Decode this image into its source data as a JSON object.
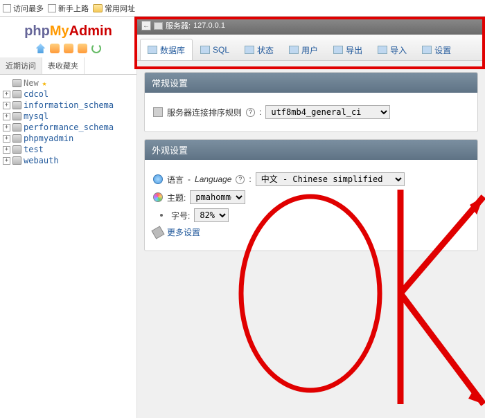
{
  "bookmarks": {
    "visit": "访问最多",
    "newbie": "新手上路",
    "common": "常用网址"
  },
  "logo": {
    "a": "php",
    "b": "My",
    "c": "Admin"
  },
  "sidebar": {
    "tab_recent": "近期访问",
    "tab_fav": "表收藏夹",
    "items": [
      "New",
      "cdcol",
      "information_schema",
      "mysql",
      "performance_schema",
      "phpmyadmin",
      "test",
      "webauth"
    ]
  },
  "server": {
    "label": "服务器:",
    "ip": "127.0.0.1"
  },
  "tabs": [
    "数据库",
    "SQL",
    "状态",
    "用户",
    "导出",
    "导入",
    "设置"
  ],
  "panel_general": {
    "title": "常规设置",
    "collation_label": "服务器连接排序规则",
    "collation_value": "utf8mb4_general_ci"
  },
  "panel_appearance": {
    "title": "外观设置",
    "lang_label1": "语言",
    "lang_label2": "Language",
    "lang_value": "中文 - Chinese simplified",
    "theme_label": "主题:",
    "theme_value": "pmahomme",
    "font_label": "字号:",
    "font_value": "82%",
    "more": "更多设置"
  }
}
